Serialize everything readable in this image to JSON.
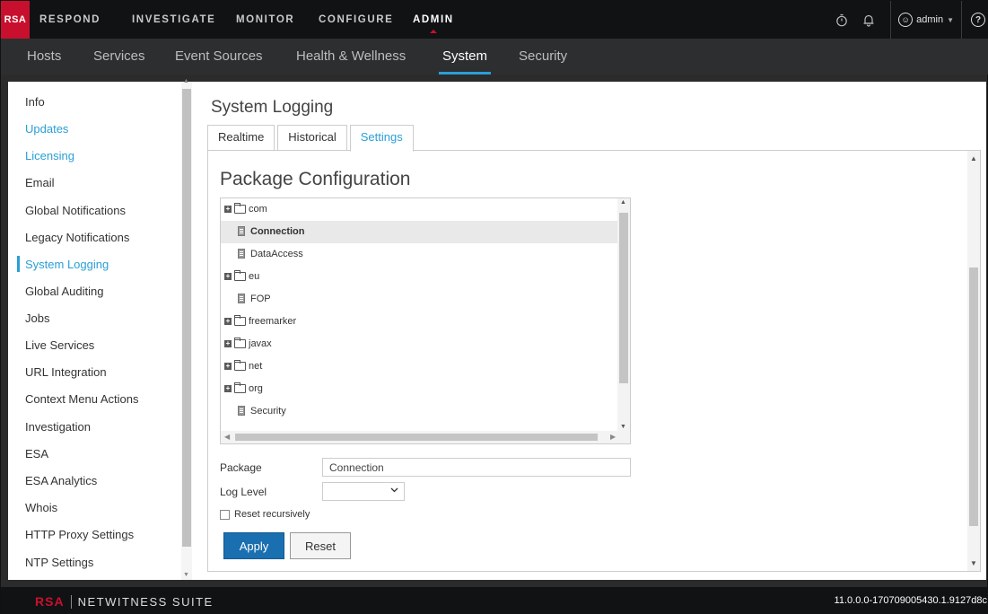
{
  "brand": {
    "logo": "RSA",
    "footer_logo": "RSA",
    "footer_suite": "NETWITNESS SUITE",
    "accent": "#c8102e",
    "link": "#2a9fd6"
  },
  "topnav": {
    "items": [
      {
        "label": "RESPOND"
      },
      {
        "label": "INVESTIGATE"
      },
      {
        "label": "MONITOR"
      },
      {
        "label": "CONFIGURE"
      },
      {
        "label": "ADMIN",
        "active": true
      }
    ],
    "icons": [
      "stopwatch-icon",
      "bell-icon",
      "user-icon",
      "help-icon"
    ],
    "user": "admin"
  },
  "subnav": {
    "items": [
      {
        "label": "Hosts"
      },
      {
        "label": "Services"
      },
      {
        "label": "Event Sources"
      },
      {
        "label": "Health & Wellness"
      },
      {
        "label": "System",
        "active": true
      },
      {
        "label": "Security"
      }
    ]
  },
  "sidebar": {
    "items": [
      {
        "label": "Info"
      },
      {
        "label": "Updates",
        "link": true
      },
      {
        "label": "Licensing",
        "link": true
      },
      {
        "label": "Email"
      },
      {
        "label": "Global Notifications"
      },
      {
        "label": "Legacy Notifications"
      },
      {
        "label": "System Logging",
        "active": true
      },
      {
        "label": "Global Auditing"
      },
      {
        "label": "Jobs"
      },
      {
        "label": "Live Services"
      },
      {
        "label": "URL Integration"
      },
      {
        "label": "Context Menu Actions"
      },
      {
        "label": "Investigation"
      },
      {
        "label": "ESA"
      },
      {
        "label": "ESA Analytics"
      },
      {
        "label": "Whois"
      },
      {
        "label": "HTTP Proxy Settings"
      },
      {
        "label": "NTP Settings"
      }
    ]
  },
  "main": {
    "title": "System Logging",
    "tabs": [
      {
        "label": "Realtime"
      },
      {
        "label": "Historical"
      },
      {
        "label": "Settings",
        "active": true
      }
    ],
    "section_title": "Package Configuration",
    "tree": [
      {
        "label": "com",
        "type": "folder",
        "expandable": true
      },
      {
        "label": "Connection",
        "type": "file",
        "selected": true
      },
      {
        "label": "DataAccess",
        "type": "file"
      },
      {
        "label": "eu",
        "type": "folder",
        "expandable": true
      },
      {
        "label": "FOP",
        "type": "file"
      },
      {
        "label": "freemarker",
        "type": "folder",
        "expandable": true
      },
      {
        "label": "javax",
        "type": "folder",
        "expandable": true
      },
      {
        "label": "net",
        "type": "folder",
        "expandable": true
      },
      {
        "label": "org",
        "type": "folder",
        "expandable": true
      },
      {
        "label": "Security",
        "type": "file"
      }
    ],
    "form": {
      "package_label": "Package",
      "package_value": "Connection",
      "log_level_label": "Log Level",
      "log_level_value": "",
      "reset_recursively_label": "Reset recursively",
      "apply_label": "Apply",
      "reset_label": "Reset"
    }
  },
  "footer": {
    "version": "11.0.0.0-170709005430.1.9127d8c"
  }
}
